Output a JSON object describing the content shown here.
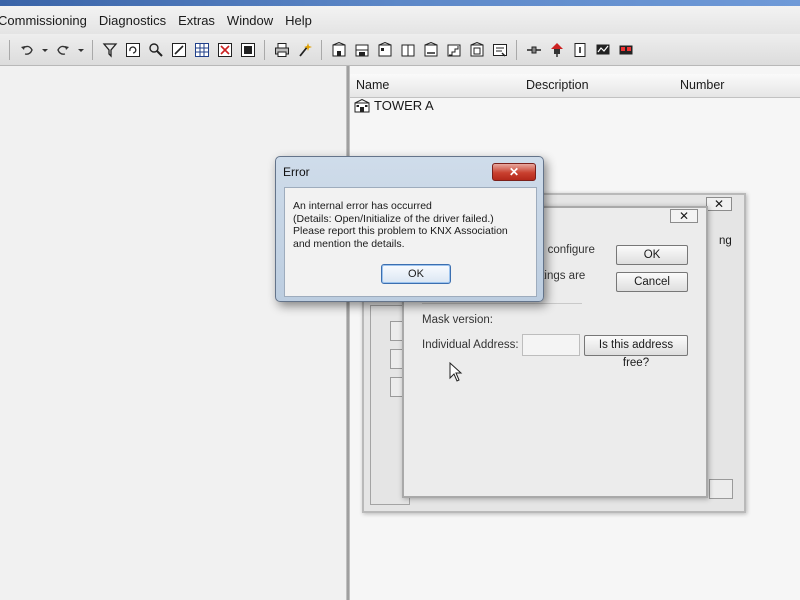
{
  "menu": {
    "items": [
      "Commissioning",
      "Diagnostics",
      "Extras",
      "Window",
      "Help"
    ]
  },
  "toolbar": {
    "icons": [
      "undo-icon",
      "undo-dropdown-icon",
      "redo-icon",
      "redo-dropdown-icon",
      "filter-icon",
      "refresh-icon",
      "find-icon",
      "properties-icon",
      "grid-view-icon",
      "delete-icon",
      "window-icon",
      "print-icon",
      "wizard-icon",
      "building-icon",
      "floor-icon",
      "room-icon",
      "cabinet-icon",
      "corridor-icon",
      "stairs-icon",
      "distribution-icon",
      "function-icon",
      "connector-icon",
      "device-icon",
      "info-icon",
      "monitor-icon",
      "bus-icon"
    ]
  },
  "list": {
    "columns": [
      "Name",
      "Description",
      "Number"
    ],
    "rows": [
      {
        "icon": "building-icon",
        "name": "TOWER A"
      }
    ]
  },
  "background_dialog": {
    "partial_text_1": "ng",
    "close_label": "✕"
  },
  "device_dialog": {
    "close_label": "✕",
    "text_configure": "o configure",
    "text_settings": "ttings are",
    "ok_label": "OK",
    "cancel_label": "Cancel",
    "mask_version_label": "Mask version:",
    "individual_address_label": "Individual Address:",
    "individual_address_value": "",
    "check_address_button": "Is this address free?"
  },
  "error_dialog": {
    "title": "Error",
    "close_label": "✕",
    "message": "An internal error has occurred\n(Details: Open/Initialize of the driver failed.)\nPlease report this problem to KNX Association\nand mention the details.",
    "ok_label": "OK"
  },
  "colors": {
    "close_button_red": "#c9402f",
    "focus_blue": "#3c6fb0"
  }
}
